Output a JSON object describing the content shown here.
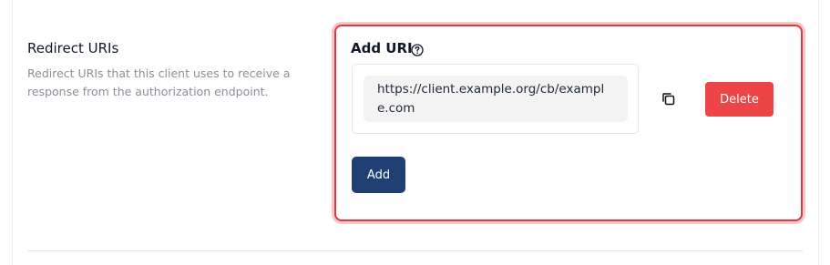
{
  "section": {
    "title": "Redirect URIs",
    "description": "Redirect URIs that this client uses to receive a response from the authorization endpoint."
  },
  "panel": {
    "label": "Add URI",
    "help_icon": "question-circle-icon",
    "uris": [
      {
        "value": "https://client.example.org/cb/example.com",
        "copy_icon": "copy-icon",
        "delete_label": "Delete"
      }
    ],
    "add_label": "Add"
  },
  "colors": {
    "error_border": "#e0393e",
    "delete_button": "#ec4447",
    "add_button": "#203f73"
  }
}
